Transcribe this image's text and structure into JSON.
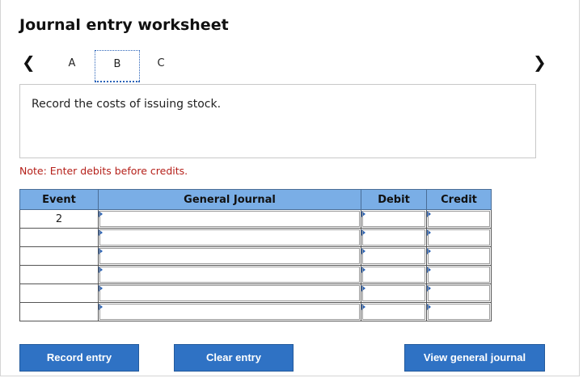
{
  "title": "Journal entry worksheet",
  "nav": {
    "prev_icon": "‹",
    "next_icon": "›"
  },
  "tabs": [
    {
      "label": "A"
    },
    {
      "label": "B",
      "active": true
    },
    {
      "label": "C"
    }
  ],
  "instruction": "Record the costs of issuing stock.",
  "note": "Note: Enter debits before credits.",
  "table": {
    "headers": [
      "Event",
      "General Journal",
      "Debit",
      "Credit"
    ],
    "rows": [
      {
        "event": "2",
        "account": "",
        "debit": "",
        "credit": ""
      },
      {
        "event": "",
        "account": "",
        "debit": "",
        "credit": ""
      },
      {
        "event": "",
        "account": "",
        "debit": "",
        "credit": ""
      },
      {
        "event": "",
        "account": "",
        "debit": "",
        "credit": ""
      },
      {
        "event": "",
        "account": "",
        "debit": "",
        "credit": ""
      },
      {
        "event": "",
        "account": "",
        "debit": "",
        "credit": ""
      }
    ]
  },
  "buttons": {
    "record": "Record entry",
    "clear": "Clear entry",
    "view": "View general journal"
  },
  "colors": {
    "header_bg": "#7aaee6",
    "button_bg": "#2f72c4",
    "note_text": "#b5201a",
    "tab_active_border": "#2a63b8"
  }
}
